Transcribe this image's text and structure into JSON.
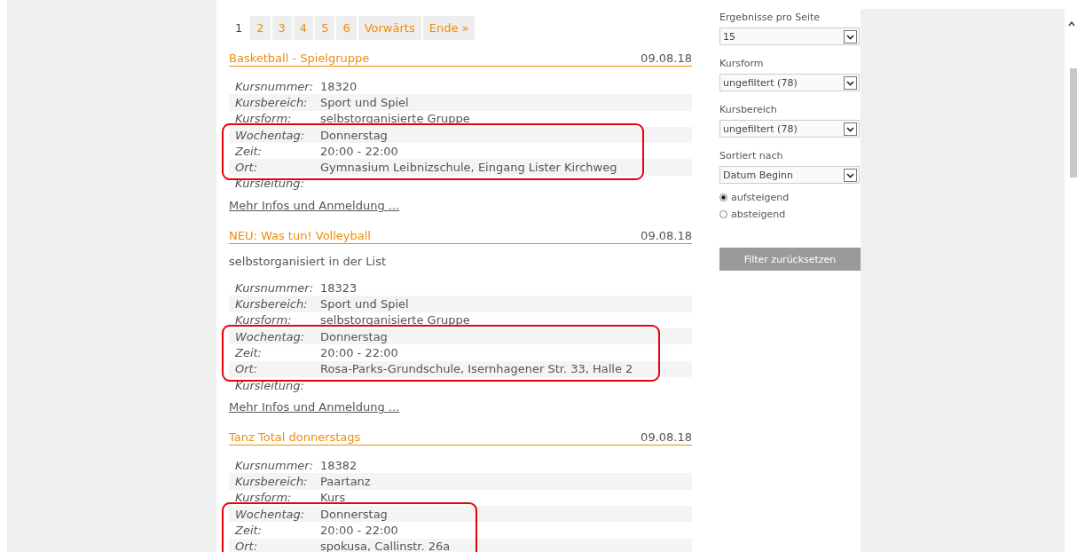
{
  "pagination": [
    {
      "label": "1",
      "selected": true
    },
    {
      "label": "2",
      "selected": false
    },
    {
      "label": "3",
      "selected": false
    },
    {
      "label": "4",
      "selected": false
    },
    {
      "label": "5",
      "selected": false
    },
    {
      "label": "6",
      "selected": false
    },
    {
      "label": "Vorwärts",
      "selected": false
    },
    {
      "label": "Ende »",
      "selected": false
    }
  ],
  "courses": [
    {
      "title": "Basketball - Spielgruppe",
      "date": "09.08.18",
      "details": [
        {
          "label": "Kursnummer:",
          "value": "18320",
          "highlighted": false
        },
        {
          "label": "Kursbereich:",
          "value": "Sport und Spiel",
          "highlighted": false
        },
        {
          "label": "Kursform:",
          "value": "selbstorganisierte Gruppe",
          "highlighted": false
        },
        {
          "label": "Wochentag:",
          "value": "Donnerstag",
          "highlighted": true
        },
        {
          "label": "Zeit:",
          "value": "20:00 - 22:00",
          "highlighted": true
        },
        {
          "label": "Ort:",
          "value": "Gymnasium Leibnizschule, Eingang Lister Kirchweg",
          "highlighted": true
        },
        {
          "label": "Kursleitung:",
          "highlighted": false
        }
      ],
      "link": "Mehr Infos und Anmeldung ..."
    },
    {
      "title": "NEU: Was tun! Volleyball",
      "date": "09.08.18",
      "description": "selbstorganisiert in der List",
      "details": [
        {
          "label": "Kursnummer:",
          "value": "18323",
          "highlighted": false
        },
        {
          "label": "Kursbereich:",
          "value": "Sport und Spiel",
          "highlighted": false
        },
        {
          "label": "Kursform:",
          "value": "selbstorganisierte Gruppe",
          "highlighted": false
        },
        {
          "label": "Wochentag:",
          "value": "Donnerstag",
          "highlighted": true
        },
        {
          "label": "Zeit:",
          "value": "20:00 - 22:00",
          "highlighted": true
        },
        {
          "label": "Ort:",
          "value": "Rosa-Parks-Grundschule, Isernhagener Str. 33, Halle 2",
          "highlighted": true
        },
        {
          "label": "Kursleitung:",
          "highlighted": false
        }
      ],
      "link": "Mehr Infos und Anmeldung ..."
    },
    {
      "title": "Tanz Total donnerstags",
      "date": "09.08.18",
      "details": [
        {
          "label": "Kursnummer:",
          "value": "18382",
          "highlighted": false
        },
        {
          "label": "Kursbereich:",
          "value": "Paartanz",
          "highlighted": false
        },
        {
          "label": "Kursform:",
          "value": "Kurs",
          "highlighted": false
        },
        {
          "label": "Wochentag:",
          "value": "Donnerstag",
          "highlighted": true
        },
        {
          "label": "Zeit:",
          "value": "20:00 - 22:00",
          "highlighted": true
        },
        {
          "label": "Ort:",
          "value": "spokusa, Callinstr. 26a",
          "highlighted": true
        }
      ]
    }
  ],
  "filters": {
    "selects": [
      {
        "label": "Ergebnisse pro Seite",
        "value": "15"
      },
      {
        "label": "Kursform",
        "value": "ungefiltert (78)"
      },
      {
        "label": "Kursbereich",
        "value": "ungefiltert (78)"
      },
      {
        "label": "Sortiert nach",
        "value": "Datum Beginn"
      }
    ],
    "sort_order": [
      {
        "label": "aufsteigend",
        "selected": true
      },
      {
        "label": "absteigend",
        "selected": false
      }
    ],
    "reset_button": "Filter zurücksetzen"
  }
}
